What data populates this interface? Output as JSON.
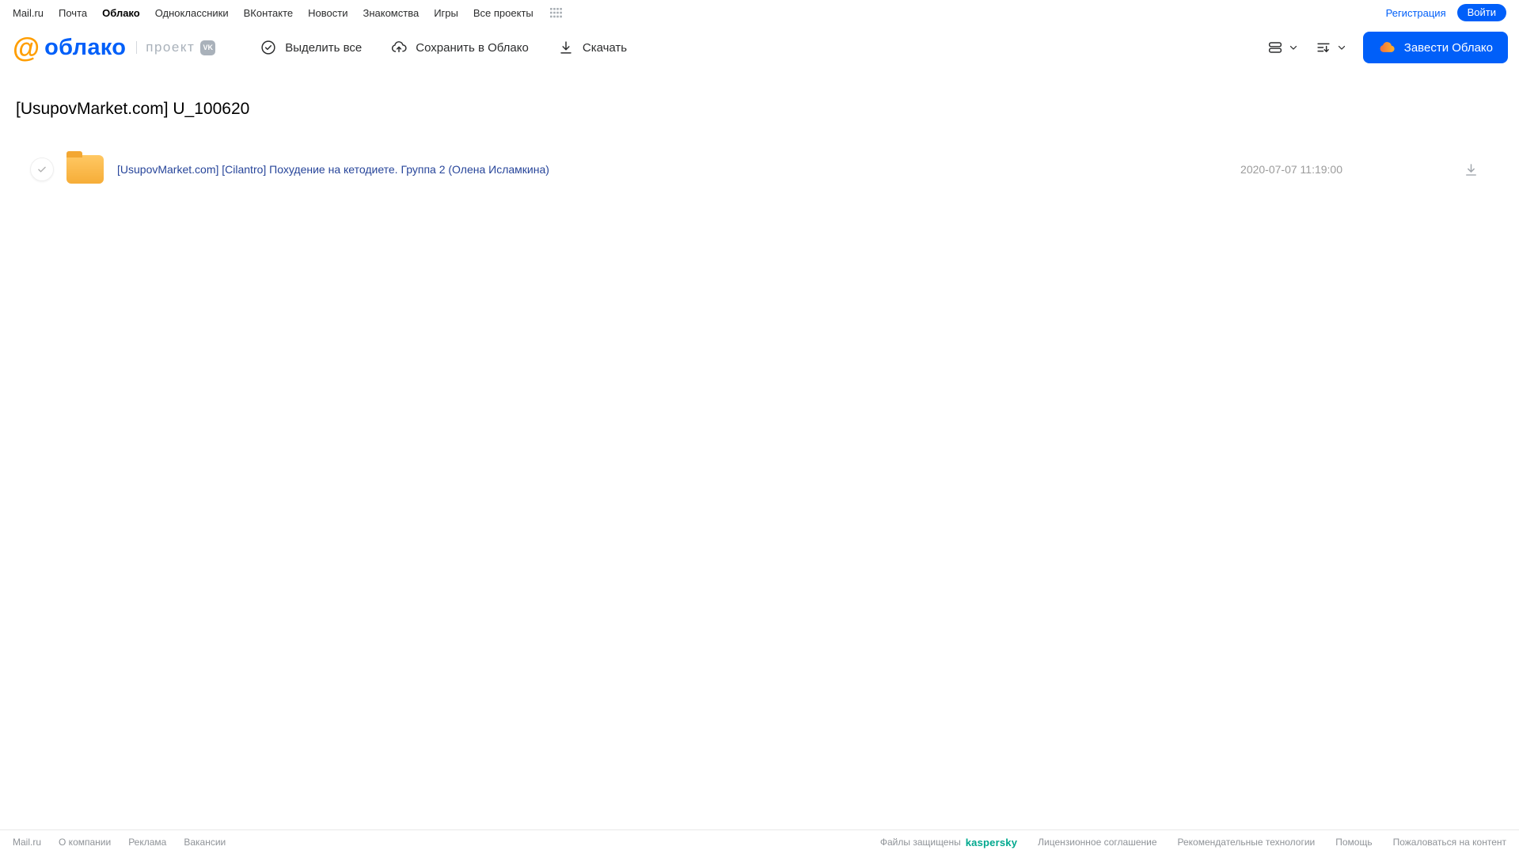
{
  "topnav": {
    "links": [
      "Mail.ru",
      "Почта",
      "Облако",
      "Одноклассники",
      "ВКонтакте",
      "Новости",
      "Знакомства",
      "Игры",
      "Все проекты"
    ],
    "active_link": "Облако",
    "registration": "Регистрация",
    "login": "Войти"
  },
  "header": {
    "logo_at": "@",
    "logo_text": "облако",
    "project_label": "проект",
    "vk_badge": "VK",
    "toolbar": [
      {
        "label": "Выделить все",
        "icon": "check-circle-icon"
      },
      {
        "label": "Сохранить в Облако",
        "icon": "cloud-upload-icon"
      },
      {
        "label": "Скачать",
        "icon": "download-icon"
      }
    ],
    "view_control_icon": "view-mode-icon",
    "sort_control_icon": "sort-icon",
    "create_cloud_button": "Завести Облако"
  },
  "main": {
    "title": "[UsupovMarket.com] U_100620",
    "files": [
      {
        "type": "folder",
        "name": "[UsupovMarket.com] [Cilantro] Похудение на кетодиете. Группа 2 (Олена Исламкина)",
        "date": "2020-07-07 11:19:00"
      }
    ]
  },
  "footer": {
    "left_links": [
      "Mail.ru",
      "О компании",
      "Реклама",
      "Вакансии"
    ],
    "protected_label": "Файлы защищены",
    "kaspersky": "kaspersky",
    "right_links": [
      "Лицензионное соглашение",
      "Рекомендательные технологии",
      "Помощь",
      "Пожаловаться на контент"
    ]
  },
  "colors": {
    "accent_blue": "#005ff9",
    "logo_orange": "#ff9e00",
    "folder_yellow": "#f6ad38",
    "file_link_navy": "#27459a",
    "kaspersky_green": "#00a88e",
    "muted_gray": "#9b9b9b"
  }
}
